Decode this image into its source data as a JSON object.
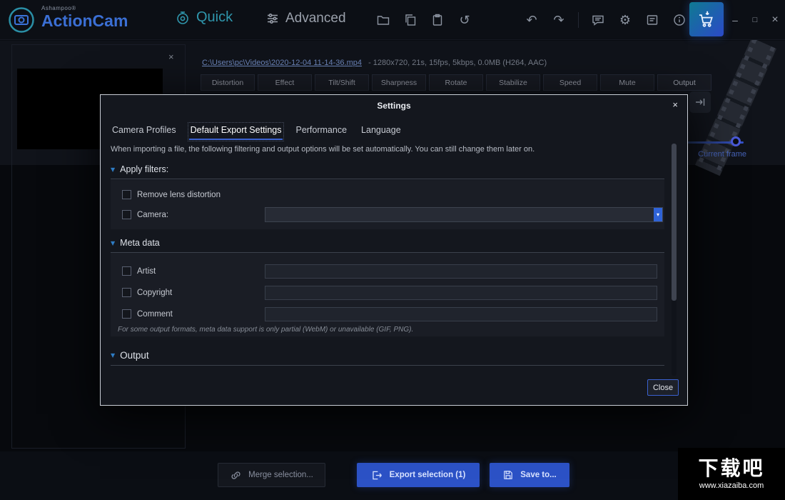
{
  "app": {
    "brand_small": "Ashampoo®",
    "brand_name": "ActionCam",
    "nav": {
      "quick": "Quick",
      "advanced": "Advanced"
    }
  },
  "icons": {
    "reset": "↺",
    "undo": "↶",
    "redo": "↷",
    "gear": "⚙",
    "minimize": "–",
    "maximize": "□",
    "close": "×",
    "preview_close": "×",
    "dialog_close": "×",
    "section_arrow": "▼",
    "dropdown_arrow": "▾"
  },
  "colors": {
    "accent_blue": "#3b62d0",
    "accent_teal": "#2f96ac",
    "button_blue": "#2c52c6"
  },
  "main": {
    "file_link": "C:\\Users\\pc\\Videos\\2020-12-04 11-14-36.mp4",
    "file_info": "-  1280x720, 21s, 15fps, 5kbps, 0.0MB (H264, AAC)",
    "tool_tabs": [
      "Distortion",
      "Effect",
      "Tilt/Shift",
      "Sharpness",
      "Rotate",
      "Stabilize",
      "Speed",
      "Mute",
      "Output"
    ],
    "current_frame_label": "Current frame",
    "buttons": {
      "merge": "Merge selection...",
      "export": "Export selection (1)",
      "save": "Save to..."
    }
  },
  "dialog": {
    "title": "Settings",
    "tabs": [
      "Camera Profiles",
      "Default Export Settings",
      "Performance",
      "Language"
    ],
    "description": "When importing a file, the following filtering and output options will be set automatically. You can still change them later on.",
    "apply_filters": {
      "title": "Apply filters:",
      "remove_lens_label": "Remove lens distortion",
      "camera_label": "Camera:"
    },
    "meta_data": {
      "title": "Meta data",
      "artist_label": "Artist",
      "copyright_label": "Copyright",
      "comment_label": "Comment",
      "note": "For some output formats, meta data support is only partial (WebM) or unavailable (GIF, PNG)."
    },
    "output": {
      "title": "Output"
    },
    "close_button": "Close"
  },
  "watermark": {
    "title": "下载吧",
    "url": "www.xiazaiba.com"
  }
}
